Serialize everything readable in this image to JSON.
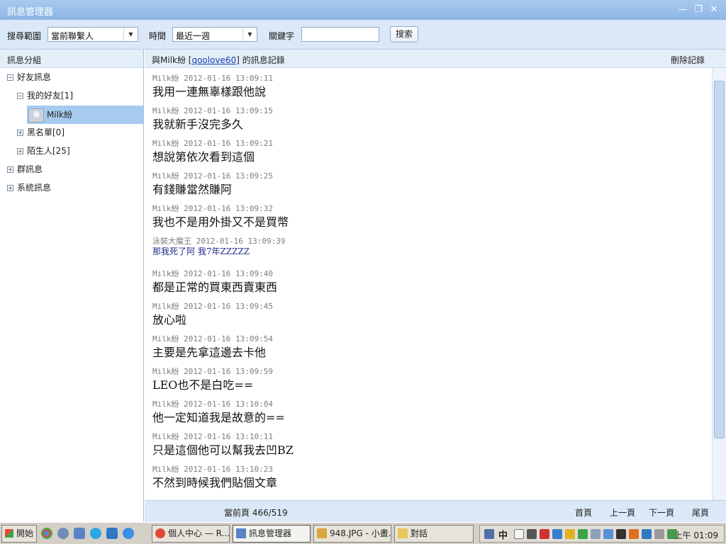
{
  "window": {
    "title": "訊息管理器",
    "minimize": "—",
    "restore": "❐",
    "close": "✕"
  },
  "toolbar": {
    "scope_label": "搜尋範圍",
    "scope_value": "當前聯繫人",
    "time_label": "時間",
    "time_value": "最近一週",
    "keyword_label": "關鍵字",
    "keyword_value": "",
    "search_button": "搜索"
  },
  "sidebar": {
    "header": "訊息分組",
    "friend_msgs": "好友訊息",
    "my_friends": "我的好友[1]",
    "contact": "Milk紛",
    "blacklist": "黑名單[0]",
    "strangers": "陌生人[25]",
    "group_msgs": "群訊息",
    "system_msgs": "系統訊息"
  },
  "main": {
    "head_prefix": "與Milk紛 [",
    "head_link": "qoolove60",
    "head_suffix": "] 的訊息記錄",
    "delete": "刪除記錄"
  },
  "messages": [
    {
      "meta": "Milk紛 2012-01-16 13:09:11",
      "text": "我用一連無辜樣跟他說"
    },
    {
      "meta": "Milk紛 2012-01-16 13:09:15",
      "text": "我就新手沒完多久"
    },
    {
      "meta": "Milk紛 2012-01-16 13:09:21",
      "text": "想說第依次看到這個"
    },
    {
      "meta": "Milk紛 2012-01-16 13:09:25",
      "text": "有錢賺當然賺阿"
    },
    {
      "meta": "Milk紛 2012-01-16 13:09:32",
      "text": "我也不是用外掛又不是買幣"
    },
    {
      "meta": "泳裝大魔王 2012-01-16 13:09:39",
      "text": "那我死了阿  我7年ZZZZZ"
    },
    {
      "meta": "Milk紛 2012-01-16 13:09:40",
      "text": "都是正常的買東西賣東西"
    },
    {
      "meta": "Milk紛 2012-01-16 13:09:45",
      "text": "放心啦"
    },
    {
      "meta": "Milk紛 2012-01-16 13:09:54",
      "text": "主要是先拿這邊去卡他"
    },
    {
      "meta": "Milk紛 2012-01-16 13:09:59",
      "text": "LEO也不是白吃=="
    },
    {
      "meta": "Milk紛 2012-01-16 13:10:04",
      "text": "他一定知道我是故意的=="
    },
    {
      "meta": "Milk紛 2012-01-16 13:10:11",
      "text": "只是這個他可以幫我去凹BZ"
    },
    {
      "meta": "Milk紛 2012-01-16 13:10:23",
      "text": "不然到時候我們貼個文章"
    }
  ],
  "pager": {
    "current": "當前頁 466/519",
    "first": "首頁",
    "prev": "上一頁",
    "next": "下一頁",
    "last": "尾頁"
  },
  "taskbar": {
    "start": "開始",
    "tasks": [
      "個人中心 — R...",
      "訊息管理器",
      "948.JPG - 小畫...",
      "對話"
    ],
    "ime": "中",
    "clock": "上午 01:09"
  }
}
